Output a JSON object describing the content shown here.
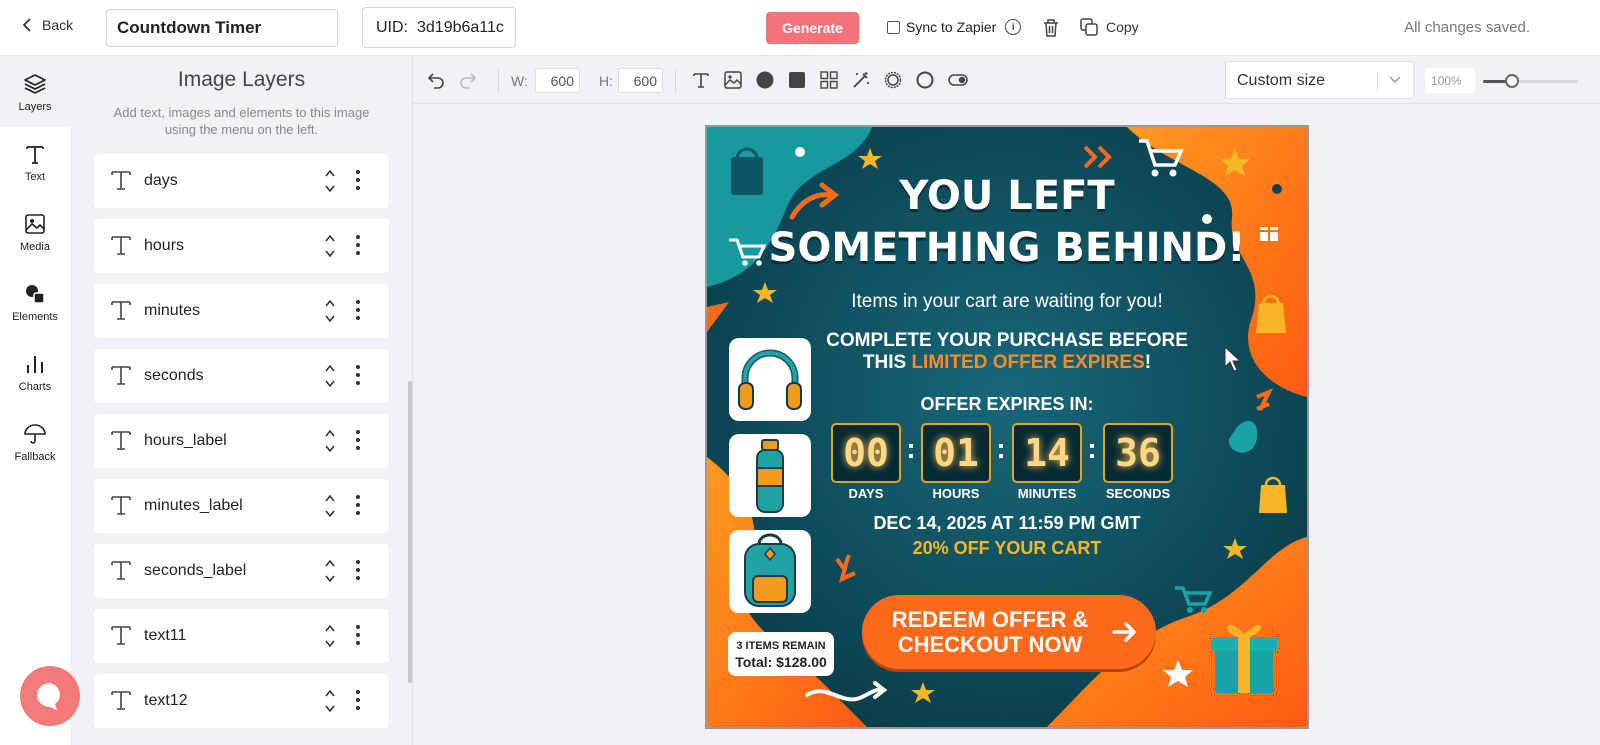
{
  "topbar": {
    "back_label": "Back",
    "template_name": "Countdown Timer",
    "uid_label": "UID:",
    "uid_value": "3d19b6a11c",
    "generate_label": "Generate",
    "sync_label": "Sync to Zapier",
    "sync_checked": false,
    "copy_label": "Copy",
    "status": "All changes saved."
  },
  "rail": {
    "items": [
      {
        "label": "Layers",
        "icon": "layers-icon",
        "active": true
      },
      {
        "label": "Text",
        "icon": "text-icon"
      },
      {
        "label": "Media",
        "icon": "image-icon"
      },
      {
        "label": "Elements",
        "icon": "shapes-icon"
      },
      {
        "label": "Charts",
        "icon": "bar-chart-icon"
      },
      {
        "label": "Fallback",
        "icon": "umbrella-icon"
      }
    ]
  },
  "panel": {
    "title": "Image Layers",
    "subtitle": "Add text, images and elements to this image using the menu on the left.",
    "layers": [
      "days",
      "hours",
      "minutes",
      "seconds",
      "hours_label",
      "minutes_label",
      "seconds_label",
      "text11",
      "text12"
    ]
  },
  "canvas_toolbar": {
    "width_label": "W:",
    "width_value": "600",
    "height_label": "H:",
    "height_value": "600",
    "tools": [
      "text-tool-icon",
      "image-tool-icon",
      "circle-tool-icon",
      "square-tool-icon",
      "grid-tool-icon",
      "magic-wand-icon",
      "ring-tool-icon",
      "circle-outline-icon",
      "toggle-tool-icon"
    ],
    "size_select": "Custom size",
    "zoom": "100%",
    "zoom_level": 0.3
  },
  "artboard": {
    "headline_1": "YOU LEFT",
    "headline_2": "SOMETHING BEHIND!",
    "subheading": "Items in your cart are waiting for you!",
    "complete_line": "COMPLETE YOUR PURCHASE BEFORE",
    "this_prefix": "THIS",
    "limited_offer": "LIMITED OFFER EXPIRES",
    "exclaim": "!",
    "offer_expires": "OFFER EXPIRES IN:",
    "countdown": [
      {
        "value": "00",
        "label": "DAYS"
      },
      {
        "value": "01",
        "label": "HOURS"
      },
      {
        "value": "14",
        "label": "MINUTES"
      },
      {
        "value": "36",
        "label": "SECONDS"
      }
    ],
    "colon": ":",
    "deadline": "DEC 14, 2025 AT 11:59 PM GMT",
    "discount": "20% OFF YOUR CART",
    "cta_line1": "REDEEM OFFER &",
    "cta_line2": "CHECKOUT NOW",
    "items_remain": "3 ITEMS REMAIN",
    "total": "Total: $128.00",
    "products": [
      "headphones-icon",
      "water-bottle-icon",
      "backpack-icon"
    ],
    "colors": {
      "teal": "#0d4a58",
      "orange": "#ff6a1a",
      "yellow": "#f8b626",
      "digit_border": "#e5a31f"
    }
  }
}
